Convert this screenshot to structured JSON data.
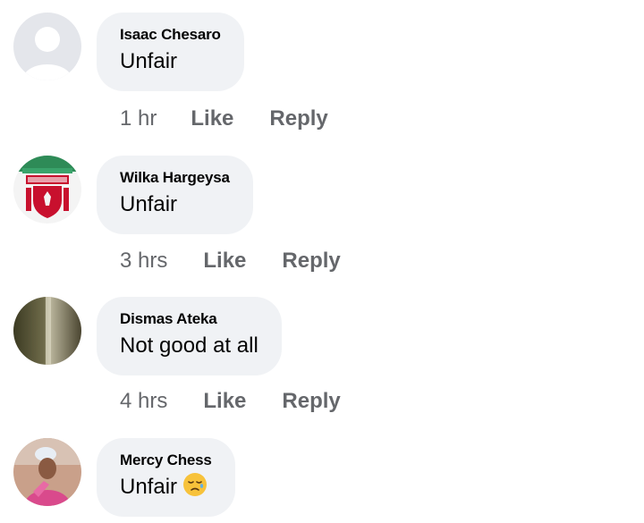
{
  "comments": [
    {
      "author": "Isaac Chesaro",
      "text": "Unfair",
      "time": "1 hr",
      "like_label": "Like",
      "reply_label": "Reply",
      "avatar": "default-avatar"
    },
    {
      "author": "Wilka Hargeysa",
      "text": "Unfair",
      "time": "3 hrs",
      "like_label": "Like",
      "reply_label": "Reply",
      "avatar": "liverpool-crest-avatar"
    },
    {
      "author": "Dismas Ateka",
      "text": "Not good at all",
      "time": "4 hrs",
      "like_label": "Like",
      "reply_label": "Reply",
      "avatar": "photo-avatar"
    },
    {
      "author": "Mercy Chess",
      "text": "Unfair",
      "emoji": "sad-relieved-face-emoji",
      "avatar": "photo-avatar"
    }
  ],
  "colors": {
    "bubble": "#f0f2f5",
    "meta_text": "#65676b",
    "author_text": "#050505"
  }
}
